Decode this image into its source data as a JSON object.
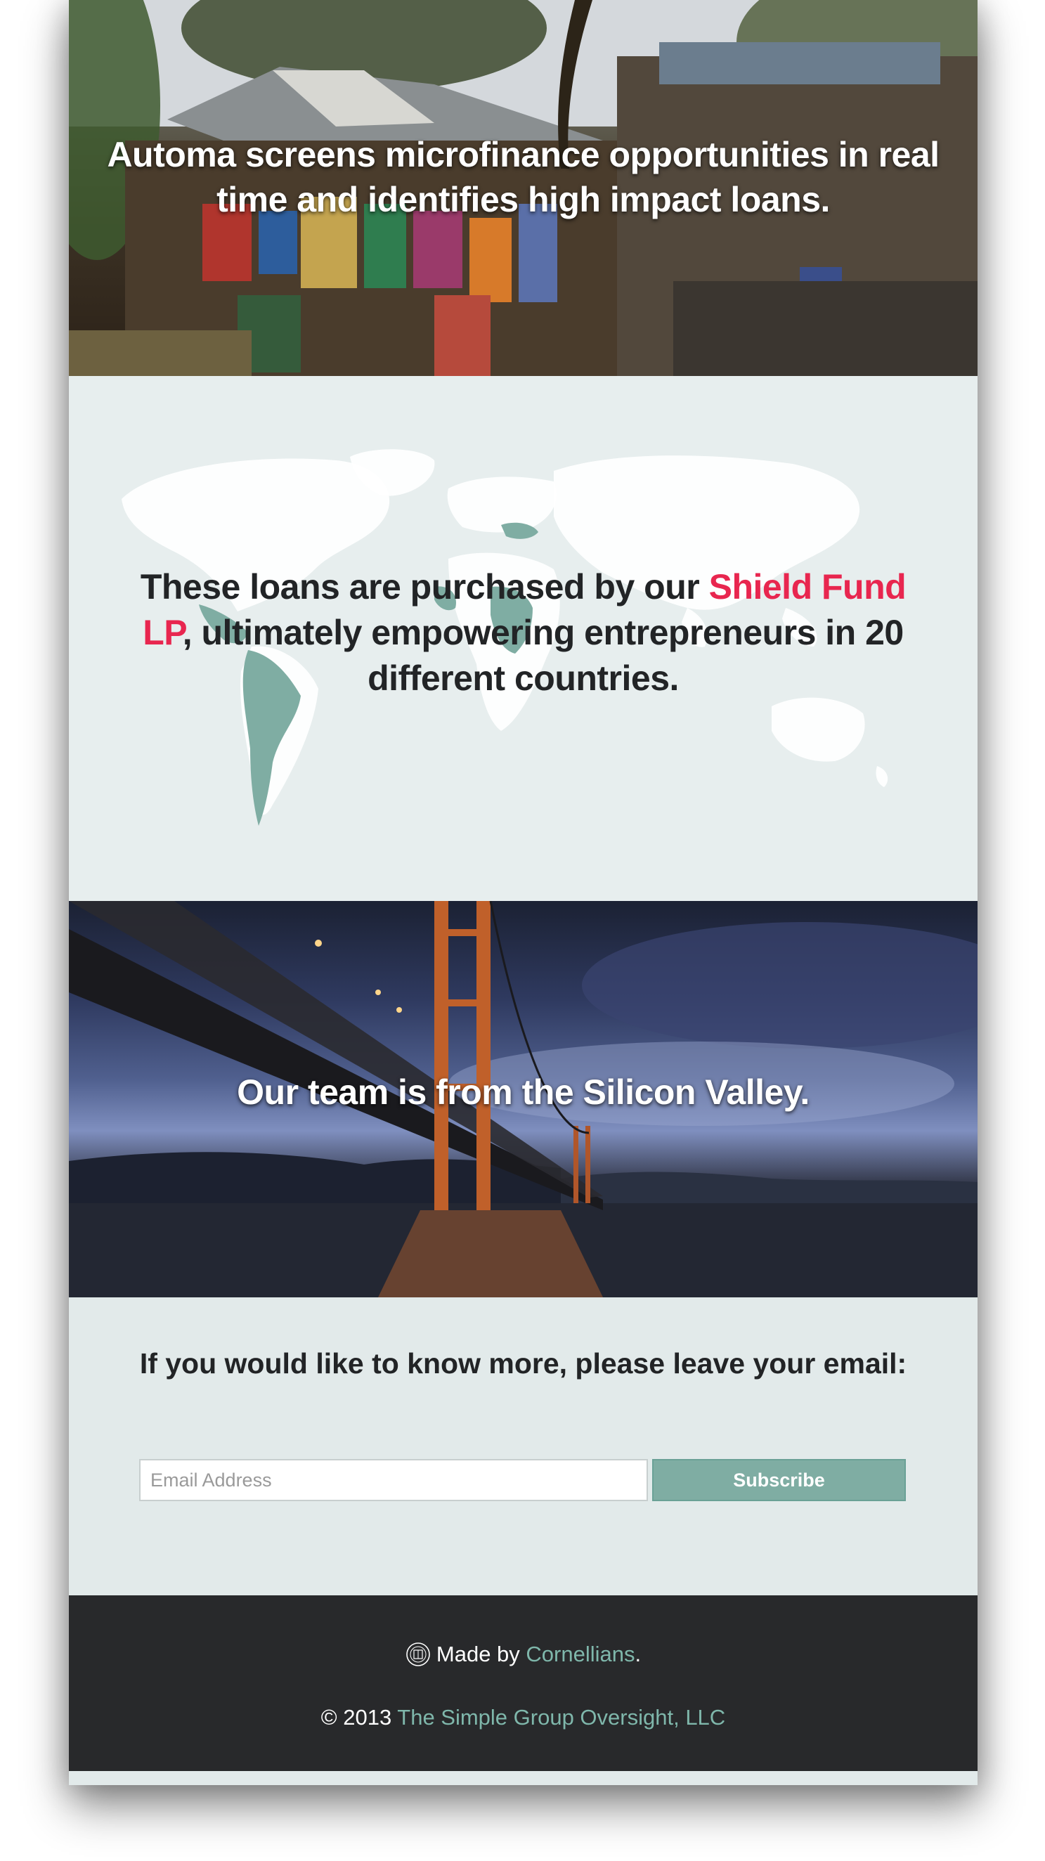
{
  "hero": {
    "title": "Automa screens microfinance opportunities in real time and identifies high impact loans."
  },
  "map_section": {
    "text_before": "These loans are purchased by our ",
    "highlight": "Shield Fund LP",
    "text_after": ", ultimately empowering entrepreneurs in 20 different countries.",
    "highlight_color": "#e8264f"
  },
  "bridge_section": {
    "title": "Our team is from the Silicon Valley."
  },
  "subscribe": {
    "title": "If you would like to know more, please leave your email:",
    "email_placeholder": "Email Address",
    "button_label": "Subscribe",
    "button_color": "#7fada3"
  },
  "footer": {
    "made_by_prefix": "Made by ",
    "made_by_link": "Cornellians",
    "made_by_suffix": ".",
    "copyright_prefix": "© 2013 ",
    "copyright_link": "The Simple Group Oversight, LLC",
    "link_color": "#7fb7ab",
    "seal_icon": "university-seal-icon"
  }
}
